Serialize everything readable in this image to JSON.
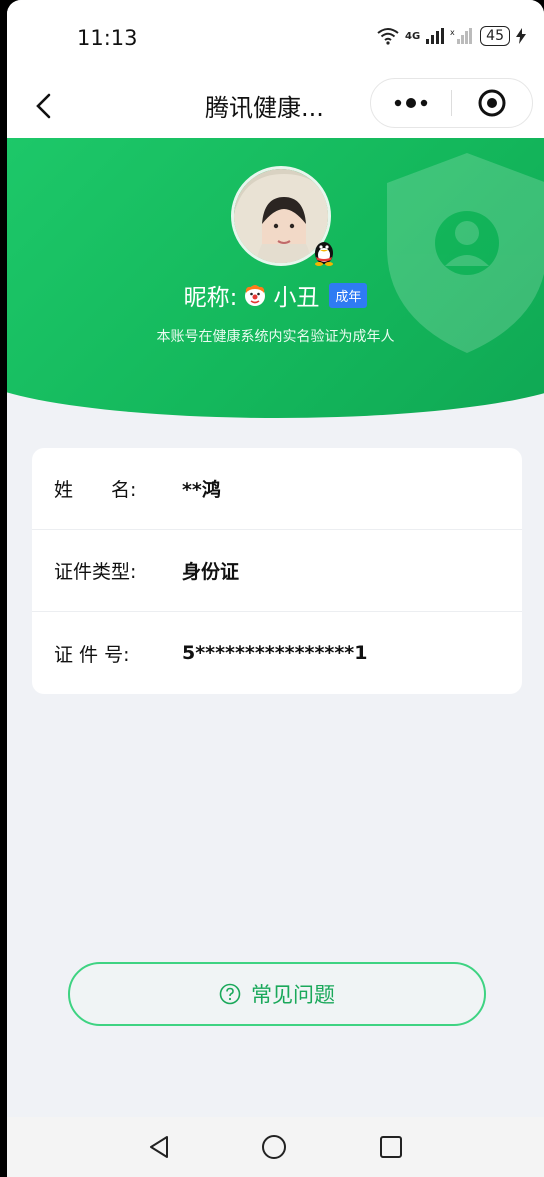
{
  "status_bar": {
    "time": "11:13",
    "network_1": "4G",
    "battery": "45"
  },
  "nav": {
    "title": "腾讯健康...",
    "icons": [
      "back-arrow-icon",
      "more-dots-icon",
      "close-target-icon"
    ]
  },
  "profile": {
    "nickname_label": "昵称:",
    "nickname": "小丑",
    "adult_tag": "成年",
    "verify_note": "本账号在健康系统内实名验证为成年人"
  },
  "info": {
    "rows": [
      {
        "label": "姓　　名:",
        "value": "**鸿"
      },
      {
        "label": "证件类型:",
        "value": "身份证"
      },
      {
        "label": "证 件 号:",
        "value": "5****************1"
      }
    ]
  },
  "faq": {
    "label": "常见问题"
  },
  "colors": {
    "accent_green": "#14b85c",
    "tag_blue": "#2f7bf3"
  }
}
